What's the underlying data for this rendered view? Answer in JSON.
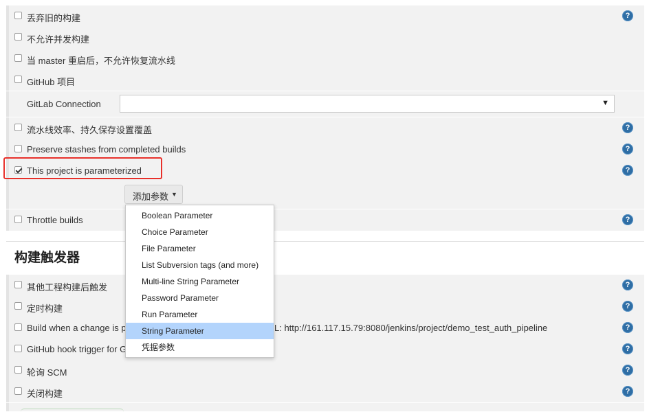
{
  "options": [
    {
      "label": "丢弃旧的构建",
      "checked": false,
      "help": true
    },
    {
      "label": "不允许并发构建",
      "checked": false,
      "help": false
    },
    {
      "label": "当 master 重启后，不允许恢复流水线",
      "checked": false,
      "help": false
    },
    {
      "label": "GitHub 项目",
      "checked": false,
      "help": false
    }
  ],
  "gitlab": {
    "label": "GitLab Connection",
    "value": "",
    "arrow": "▼"
  },
  "options2": [
    {
      "label": "流水线效率、持久保存设置覆盖",
      "checked": false,
      "help": true
    },
    {
      "label": "Preserve stashes from completed builds",
      "checked": false,
      "help": true
    },
    {
      "label": "This project is parameterized",
      "checked": true,
      "help": true
    }
  ],
  "add_param": {
    "label": "添加参数",
    "caret": "▼"
  },
  "throttle": {
    "label": "Throttle builds",
    "checked": false,
    "help": true
  },
  "param_menu": [
    "Boolean Parameter",
    "Choice Parameter",
    "File Parameter",
    "List Subversion tags (and more)",
    "Multi-line String Parameter",
    "Password Parameter",
    "Run Parameter",
    "String Parameter",
    "凭据参数"
  ],
  "param_menu_active": "String Parameter",
  "triggers_title": "构建触发器",
  "triggers": [
    {
      "label": "其他工程构建后触发"
    },
    {
      "label": "定时构建"
    },
    {
      "label_left": "Build when a change is p",
      "label_right": "L: http://161.117.15.79:8080/jenkins/project/demo_test_auth_pipeline"
    },
    {
      "label": "GitHub hook trigger for G"
    },
    {
      "label": "轮询 SCM"
    },
    {
      "label": "关闭构建"
    }
  ],
  "help_glyph": "?",
  "colors": {
    "accent_red": "#e8302a",
    "help_blue": "#2f6ea5",
    "menu_highlight": "#b3d4fc"
  }
}
